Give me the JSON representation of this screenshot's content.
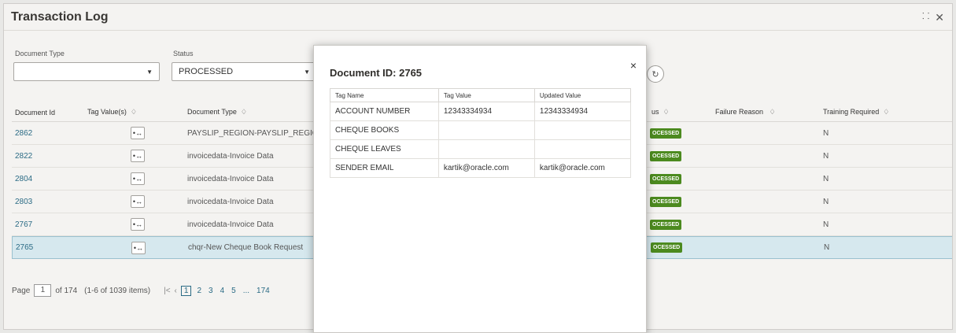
{
  "window": {
    "title": "Transaction Log"
  },
  "filters": {
    "document_type": {
      "label": "Document Type",
      "value": ""
    },
    "status": {
      "label": "Status",
      "value": "PROCESSED"
    }
  },
  "table": {
    "headers": {
      "document_id": "Document Id",
      "tag_values": "Tag Value(s)",
      "document_type": "Document Type",
      "status": "us",
      "failure_reason": "Failure Reason",
      "training_required": "Training Required"
    },
    "sort_glyph": "♢",
    "rows": [
      {
        "id": "2862",
        "doc_type": "PAYSLIP_REGION-PAYSLIP_REGION",
        "status": "OCESSED",
        "failure": "",
        "training": "N"
      },
      {
        "id": "2822",
        "doc_type": "invoicedata-Invoice Data",
        "status": "OCESSED",
        "failure": "",
        "training": "N"
      },
      {
        "id": "2804",
        "doc_type": "invoicedata-Invoice Data",
        "status": "OCESSED",
        "failure": "",
        "training": "N"
      },
      {
        "id": "2803",
        "doc_type": "invoicedata-Invoice Data",
        "status": "OCESSED",
        "failure": "",
        "training": "N"
      },
      {
        "id": "2767",
        "doc_type": "invoicedata-Invoice Data",
        "status": "OCESSED",
        "failure": "",
        "training": "N"
      },
      {
        "id": "2765",
        "doc_type": "chqr-New Cheque Book Request",
        "status": "OCESSED",
        "failure": "",
        "training": "N"
      }
    ]
  },
  "pager": {
    "page_label": "Page",
    "page_value": "1",
    "of_text": "of 174",
    "items_text": "(1-6 of 1039 items)",
    "pages": [
      "1",
      "2",
      "3",
      "4",
      "5",
      "...",
      "174"
    ]
  },
  "modal": {
    "title": "Document ID: 2765",
    "close": "×",
    "headers": [
      "Tag Name",
      "Tag Value",
      "Updated Value"
    ],
    "rows": [
      [
        "ACCOUNT NUMBER",
        "12343334934",
        "12343334934"
      ],
      [
        "CHEQUE BOOKS",
        "",
        ""
      ],
      [
        "CHEQUE LEAVES",
        "",
        ""
      ],
      [
        "SENDER EMAIL",
        "kartik@oracle.com",
        "kartik@oracle.com"
      ]
    ]
  },
  "colors": {
    "accent": "#2b6b85",
    "status_badge": "#4c8a1f",
    "selected_row": "#d6e8ee"
  }
}
